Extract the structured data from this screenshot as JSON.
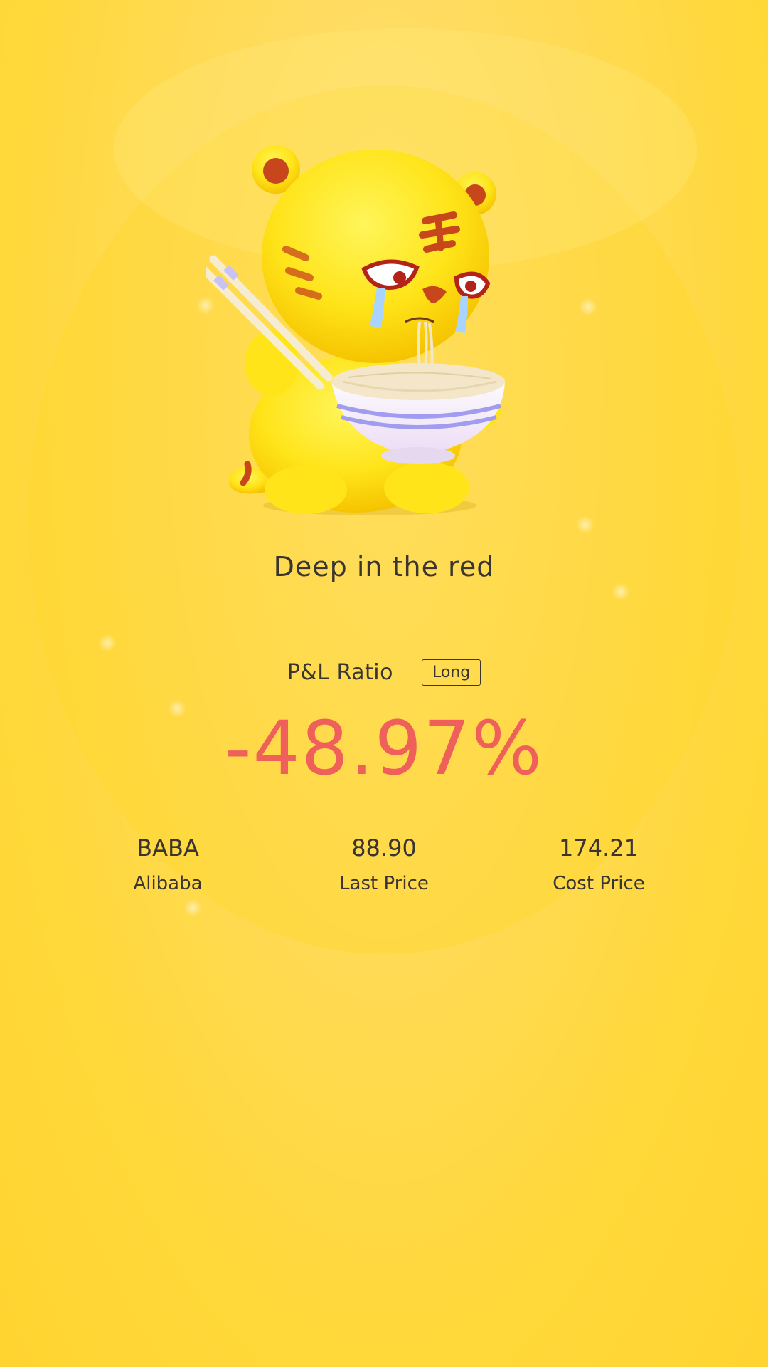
{
  "result": {
    "title": "Deep in the red",
    "mascot": "crying-tiger-eating-noodles"
  },
  "pnl": {
    "label": "P&L Ratio",
    "position_type": "Long",
    "ratio": "-48.97%"
  },
  "stats": [
    {
      "value": "BABA",
      "label": "Alibaba"
    },
    {
      "value": "88.90",
      "label": "Last Price"
    },
    {
      "value": "174.21",
      "label": "Cost Price"
    }
  ],
  "colors": {
    "background": "#ffd83a",
    "loss": "#f0605a",
    "text": "#3a3530"
  }
}
